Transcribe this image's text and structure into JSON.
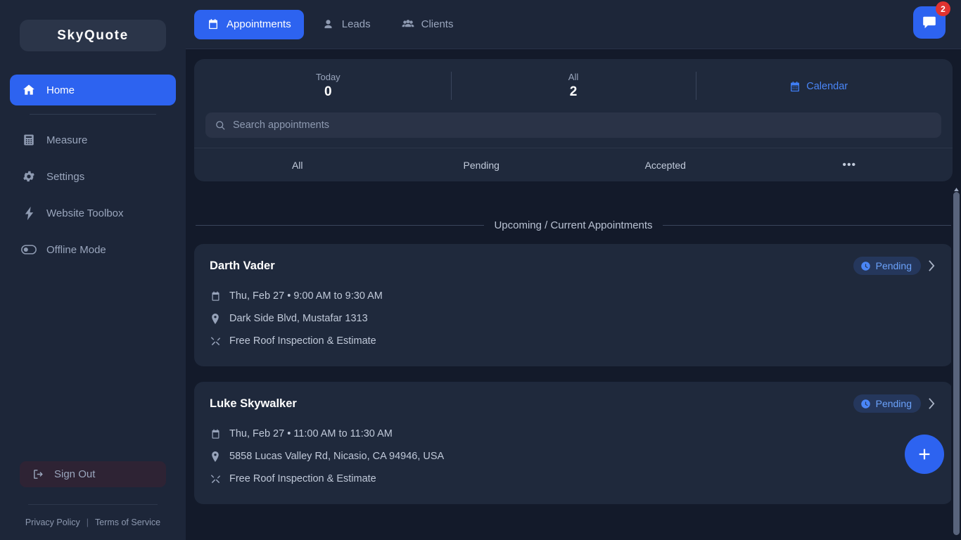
{
  "sidebar": {
    "brand": "SkyQuote",
    "items": [
      {
        "label": "Home",
        "icon": "home-icon",
        "active": true
      },
      {
        "label": "Measure",
        "icon": "calculator-icon",
        "active": false
      },
      {
        "label": "Settings",
        "icon": "gear-icon",
        "active": false
      },
      {
        "label": "Website Toolbox",
        "icon": "bolt-icon",
        "active": false
      },
      {
        "label": "Offline Mode",
        "icon": "toggle-off-icon",
        "active": false
      }
    ],
    "sign_out": "Sign Out",
    "footer": {
      "privacy": "Privacy Policy",
      "separator": "|",
      "terms": "Terms of Service"
    }
  },
  "topbar": {
    "tabs": [
      {
        "label": "Appointments",
        "icon": "calendar-icon",
        "active": true
      },
      {
        "label": "Leads",
        "icon": "person-icon",
        "active": false
      },
      {
        "label": "Clients",
        "icon": "people-icon",
        "active": false
      }
    ],
    "chat": {
      "icon": "chat-bubble-icon",
      "badge": "2"
    }
  },
  "stats": {
    "today": {
      "label": "Today",
      "value": "0"
    },
    "all": {
      "label": "All",
      "value": "2"
    },
    "calendar": {
      "label": "Calendar",
      "icon": "calendar-icon"
    }
  },
  "search": {
    "placeholder": "Search appointments",
    "value": "",
    "icon": "search-icon"
  },
  "filters": [
    {
      "label": "All"
    },
    {
      "label": "Pending"
    },
    {
      "label": "Accepted"
    },
    {
      "label": "•••"
    }
  ],
  "section": {
    "title": "Upcoming / Current Appointments"
  },
  "appointments": [
    {
      "name": "Darth Vader",
      "status": "Pending",
      "status_icon": "clock-icon",
      "datetime": "Thu, Feb 27 • 9:00 AM to 9:30 AM",
      "address": "Dark Side Blvd, Mustafar 1313",
      "service": "Free Roof Inspection & Estimate"
    },
    {
      "name": "Luke Skywalker",
      "status": "Pending",
      "status_icon": "clock-icon",
      "datetime": "Thu, Feb 27 • 11:00 AM to 11:30 AM",
      "address": "5858 Lucas Valley Rd, Nicasio, CA 94946, USA",
      "service": "Free Roof Inspection & Estimate"
    }
  ],
  "fab": {
    "icon": "plus-icon"
  },
  "colors": {
    "accent": "#2d63f0",
    "badge_red": "#e0322f",
    "sidebar_bg": "#1d2639",
    "main_bg": "#131a2a",
    "panel_bg": "#1f293c",
    "status_text": "#6ba2fb"
  }
}
